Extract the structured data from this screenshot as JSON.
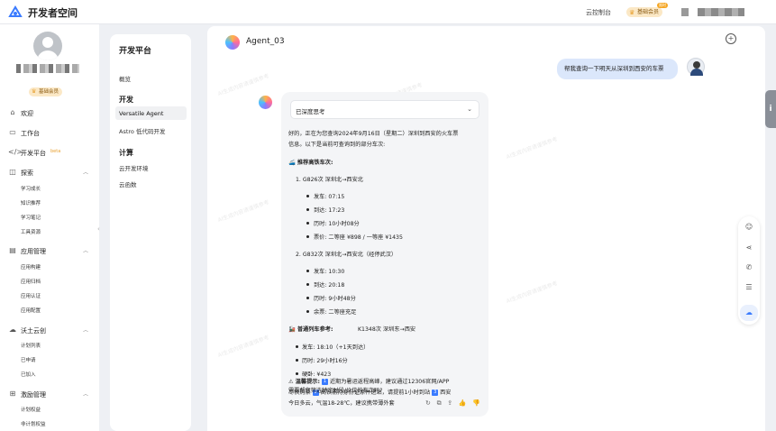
{
  "app": {
    "brand": "开发者空间",
    "console": "云控制台",
    "member_badge": "基础会员",
    "member_tag": "限时"
  },
  "sidebar": {
    "badge": "基础会员",
    "nav": [
      {
        "label": "欢迎",
        "icon": "home-icon"
      },
      {
        "label": "工作台",
        "icon": "desk-icon"
      },
      {
        "label": "开发平台",
        "icon": "code-icon",
        "beta": "beta"
      },
      {
        "label": "探索",
        "icon": "explore-icon"
      },
      {
        "label": "应用管理",
        "icon": "app-icon"
      },
      {
        "label": "沃土云创",
        "icon": "cloud-icon"
      },
      {
        "label": "激励管理",
        "icon": "gift-icon"
      }
    ],
    "explore_subs": [
      "学习成长",
      "知识推荐",
      "学习笔记",
      "工具资源"
    ],
    "app_subs": [
      "应用构建",
      "应用归档",
      "应用认证",
      "应用配置"
    ],
    "cloud_subs": [
      "计划列表",
      "已申请",
      "已加入"
    ],
    "incentive_subs": [
      "计划权益",
      "非计划权益"
    ]
  },
  "panel": {
    "title": "开发平台",
    "overview": "概览",
    "sec_dev": "开发",
    "dev_items": [
      "Versatile Agent",
      "Astro 低代码开发"
    ],
    "sec_compute": "计算",
    "compute_items": [
      "云开发环境",
      "云函数"
    ]
  },
  "chat": {
    "agent_name": "Agent_03",
    "user_msg": "帮我查询一下明天从深圳到西安的车票",
    "think_label": "已深度思考",
    "intro1": "好的，正在为您查询2024年9月16日（星期二）深圳到西安的火车票",
    "intro2": "信息。以下是当前可查询到的部分车次:",
    "hs_title": "🚄 推荐高铁车次:",
    "t1_title": "1. G826次 深圳北→西安北",
    "t1": [
      "发车: 07:15",
      "到达: 17:23",
      "历时: 10小时08分",
      "票价: 二等座 ¥898 / 一等座 ¥1435"
    ],
    "t2_title": "2. G832次 深圳北→西安北（经停武汉）",
    "t2": [
      "发车: 10:30",
      "到达: 20:18",
      "历时: 9小时48分",
      "余票: 二等座充足"
    ],
    "normal_title": "🚂 普通列车参考:",
    "normal_route": "K1348次 深圳东→西安",
    "t3": [
      "发车: 18:10（+1天到达）",
      "历时: 29小时16分",
      "硬卧: ¥423"
    ],
    "tip_a": "⚠ 温馨提示:",
    "tip_n1": "1",
    "tip_b": "近期为暑运返程高峰，建议通过12306官网/APP",
    "tip_c": "尽快购票",
    "tip_n2": "2",
    "tip_d": "高铁需持身份证原件进站，请提前1小时到站",
    "tip_n3": "3",
    "tip_e": "西安",
    "tip_f": "今日多云，气温18-28℃，建议携带薄外套",
    "question": "需要帮您筛选特定时段/价位的车次吗?",
    "watermark": "AI生成内容请谨慎参考"
  }
}
